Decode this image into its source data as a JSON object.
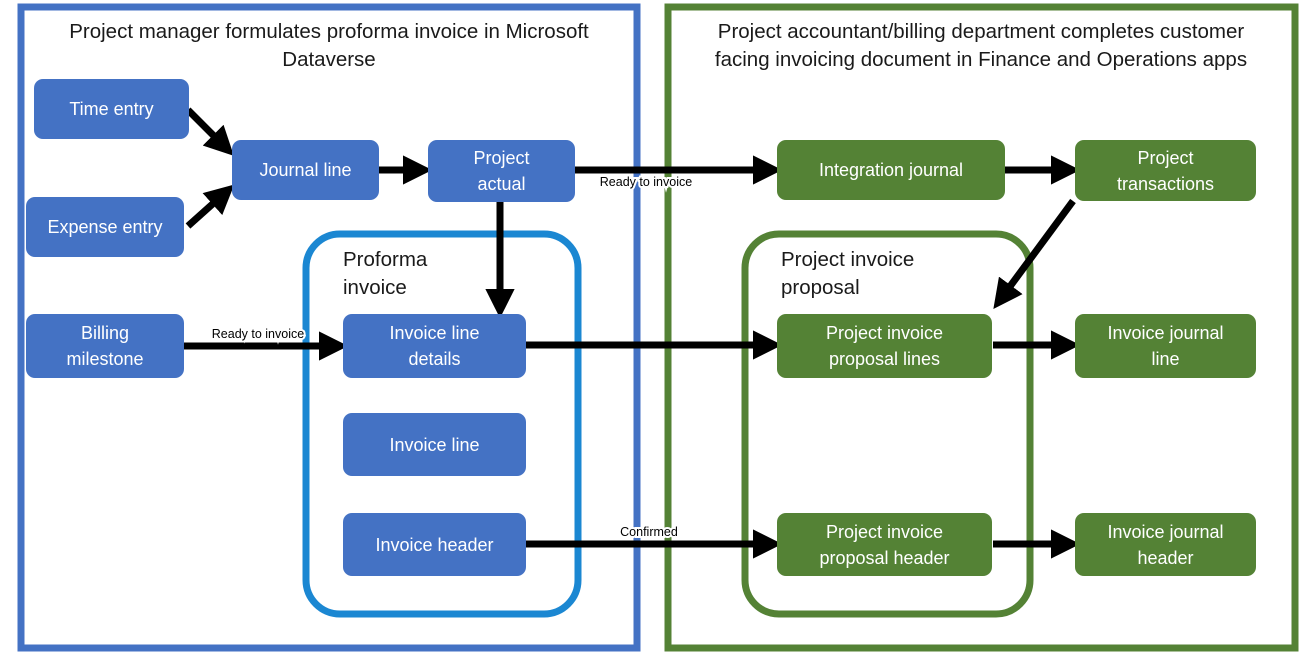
{
  "diagram": {
    "title_visible": false,
    "colors": {
      "node_blue": "#4472C4",
      "node_green": "#548235",
      "container_blue_border": "#4472C4",
      "container_green_border": "#548235",
      "group_blue_border": "#1B87D2",
      "group_green_border": "#548235",
      "arrow": "#000000",
      "node_text": "#FFFFFF",
      "title_text": "#1A1A1A",
      "background": "#FFFFFF"
    },
    "containers": [
      {
        "id": "left-container",
        "title": "Project manager formulates proforma invoice in Microsoft Dataverse",
        "title_line1": "Project manager formulates proforma invoice in Microsoft",
        "title_line2": "Dataverse",
        "accent": "#4472C4"
      },
      {
        "id": "right-container",
        "title": "Project accountant/billing department completes customer facing invoicing document in Finance and Operations apps",
        "title_line1": "Project accountant/billing department completes customer",
        "title_line2": "facing invoicing document in Finance and Operations apps",
        "accent": "#548235"
      }
    ],
    "groups": [
      {
        "id": "proforma-invoice-group",
        "title_line1": "Proforma",
        "title_line2": "invoice",
        "accent": "#1B87D2"
      },
      {
        "id": "project-invoice-proposal-group",
        "title_line1": "Project invoice",
        "title_line2": "proposal",
        "accent": "#548235"
      }
    ],
    "nodes": [
      {
        "id": "time-entry",
        "line1": "Time entry",
        "line2": "",
        "color": "blue"
      },
      {
        "id": "expense-entry",
        "line1": "Expense entry",
        "line2": "",
        "color": "blue"
      },
      {
        "id": "journal-line",
        "line1": "Journal line",
        "line2": "",
        "color": "blue"
      },
      {
        "id": "project-actual",
        "line1": "Project",
        "line2": "actual",
        "color": "blue"
      },
      {
        "id": "billing-milestone",
        "line1": "Billing",
        "line2": "milestone",
        "color": "blue"
      },
      {
        "id": "invoice-line-details",
        "line1": "Invoice line",
        "line2": "details",
        "color": "blue"
      },
      {
        "id": "invoice-line",
        "line1": "Invoice line",
        "line2": "",
        "color": "blue"
      },
      {
        "id": "invoice-header",
        "line1": "Invoice header",
        "line2": "",
        "color": "blue"
      },
      {
        "id": "integration-journal",
        "line1": "Integration journal",
        "line2": "",
        "color": "green"
      },
      {
        "id": "project-transactions",
        "line1": "Project",
        "line2": "transactions",
        "color": "green"
      },
      {
        "id": "project-invoice-proposal-lines",
        "line1": "Project invoice",
        "line2": "proposal lines",
        "color": "green"
      },
      {
        "id": "invoice-journal-line",
        "line1": "Invoice journal",
        "line2": "line",
        "color": "green"
      },
      {
        "id": "project-invoice-proposal-header",
        "line1": "Project invoice",
        "line2": "proposal header",
        "color": "green"
      },
      {
        "id": "invoice-journal-header",
        "line1": "Invoice journal",
        "line2": "header",
        "color": "green"
      }
    ],
    "edge_labels": {
      "ready_to_invoice_top": "Ready to invoice",
      "ready_to_invoice_mid": "Ready to invoice",
      "confirmed": "Confirmed"
    }
  }
}
